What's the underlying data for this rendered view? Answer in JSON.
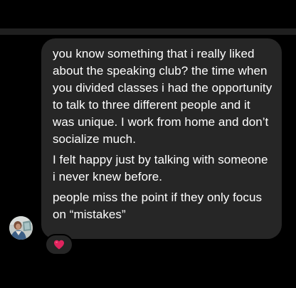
{
  "message": {
    "paragraphs": [
      "you know something that i really liked about the speaking club? the time when you divided classes i had the opportunity to talk to three different people and it was unique. I work from home and don’t socialize much.",
      "I felt happy just by talking with someone i never knew before.",
      "people miss the point if they only focus on “mistakes”"
    ],
    "bubble_color": "#262626",
    "text_color": "#ffffff"
  },
  "sender": {
    "avatar_icon": "profile-photo"
  },
  "reaction": {
    "emoji": "❤️",
    "icon": "red-heart-icon",
    "color": "#e0245e"
  },
  "theme": {
    "background": "#000000",
    "divider": "#1f1f1f"
  }
}
